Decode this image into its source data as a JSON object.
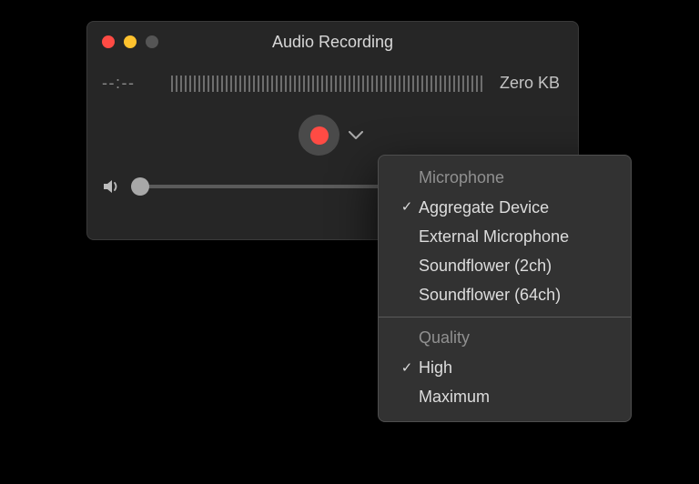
{
  "window": {
    "title": "Audio Recording",
    "time": "--:--",
    "size": "Zero KB"
  },
  "menu": {
    "microphone": {
      "header": "Microphone",
      "items": [
        {
          "label": "Aggregate Device",
          "selected": true
        },
        {
          "label": "External Microphone",
          "selected": false
        },
        {
          "label": "Soundflower (2ch)",
          "selected": false
        },
        {
          "label": "Soundflower (64ch)",
          "selected": false
        }
      ]
    },
    "quality": {
      "header": "Quality",
      "items": [
        {
          "label": "High",
          "selected": true
        },
        {
          "label": "Maximum",
          "selected": false
        }
      ]
    }
  },
  "slider": {
    "value_pct": 2
  },
  "checkmark": "✓"
}
